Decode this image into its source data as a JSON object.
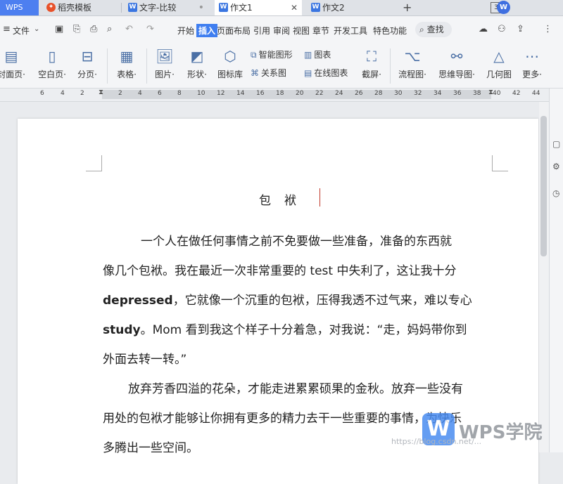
{
  "tabbar": {
    "app_name": "WPS",
    "tabs": [
      {
        "label": "稻壳模板",
        "icon": "daoke-icon"
      },
      {
        "label": "文字-比较",
        "icon": "writer-doc-icon"
      },
      {
        "label": "作文1",
        "icon": "writer-doc-icon"
      },
      {
        "label": "作文2",
        "icon": "writer-doc-icon"
      }
    ],
    "new_tab": "+",
    "badge": "3",
    "avatar_letter": "W"
  },
  "menu": {
    "file_label": "文件",
    "items": [
      "开始",
      "插入",
      "页面布局",
      "引用",
      "审阅",
      "视图",
      "章节",
      "开发工具",
      "特色功能"
    ],
    "active_item": "插入",
    "search_label": "查找"
  },
  "ribbon": {
    "big_buttons": [
      {
        "label": "封面页·",
        "icon": "cover-page-icon"
      },
      {
        "label": "空白页·",
        "icon": "blank-page-icon"
      },
      {
        "label": "分页·",
        "icon": "page-break-icon"
      },
      {
        "label": "表格·",
        "icon": "table-icon"
      },
      {
        "label": "图片·",
        "icon": "picture-icon"
      },
      {
        "label": "形状·",
        "icon": "shape-icon"
      },
      {
        "label": "图标库",
        "icon": "icon-library-icon"
      },
      {
        "label": "截屏·",
        "icon": "screenshot-icon"
      },
      {
        "label": "流程图·",
        "icon": "flowchart-icon"
      },
      {
        "label": "思维导图·",
        "icon": "mindmap-icon"
      },
      {
        "label": "几何图",
        "icon": "geometry-icon"
      },
      {
        "label": "更多·",
        "icon": "more-icon"
      }
    ],
    "small_buttons": [
      {
        "label": "智能图形",
        "icon": "smart-graphic-icon"
      },
      {
        "label": "图表",
        "icon": "chart-icon"
      },
      {
        "label": "关系图",
        "icon": "relation-chart-icon"
      },
      {
        "label": "在线图表",
        "icon": "online-chart-icon"
      }
    ]
  },
  "ruler": {
    "left_numbers": [
      "6",
      "4",
      "2"
    ],
    "right_numbers": [
      "2",
      "4",
      "6",
      "8",
      "10",
      "12",
      "14",
      "16",
      "18",
      "20",
      "22",
      "24",
      "26",
      "28",
      "30",
      "32",
      "34",
      "36",
      "38",
      "40",
      "42",
      "44"
    ]
  },
  "document": {
    "title": "包　袱",
    "paragraph1_lines": [
      "一个人在做任何事情之前不免要做一些准备，准备的东西就",
      "像几个包袱。我在最近一次非常重要的 test 中失利了，这让我十分",
      "depressed",
      "，它就像一个沉重的包袱，压得我透不过气来，难以专心",
      "study",
      "。Mom 看到我这个样子十分着急，对我说：“走，妈妈带你到",
      "外面去转一转。”"
    ],
    "paragraph2_lines": [
      "放弃芳香四溢的花朵，才能走进累累硕果的金秋。放弃一些没有",
      "用处的包袱才能够让你拥有更多的精力去干一些重要的事情，为快乐",
      "多腾出一些空间。"
    ]
  },
  "watermark": {
    "logo_letter": "W",
    "brand_text": "WPS学院",
    "url_text": "https://blog.csdn.net/..."
  }
}
